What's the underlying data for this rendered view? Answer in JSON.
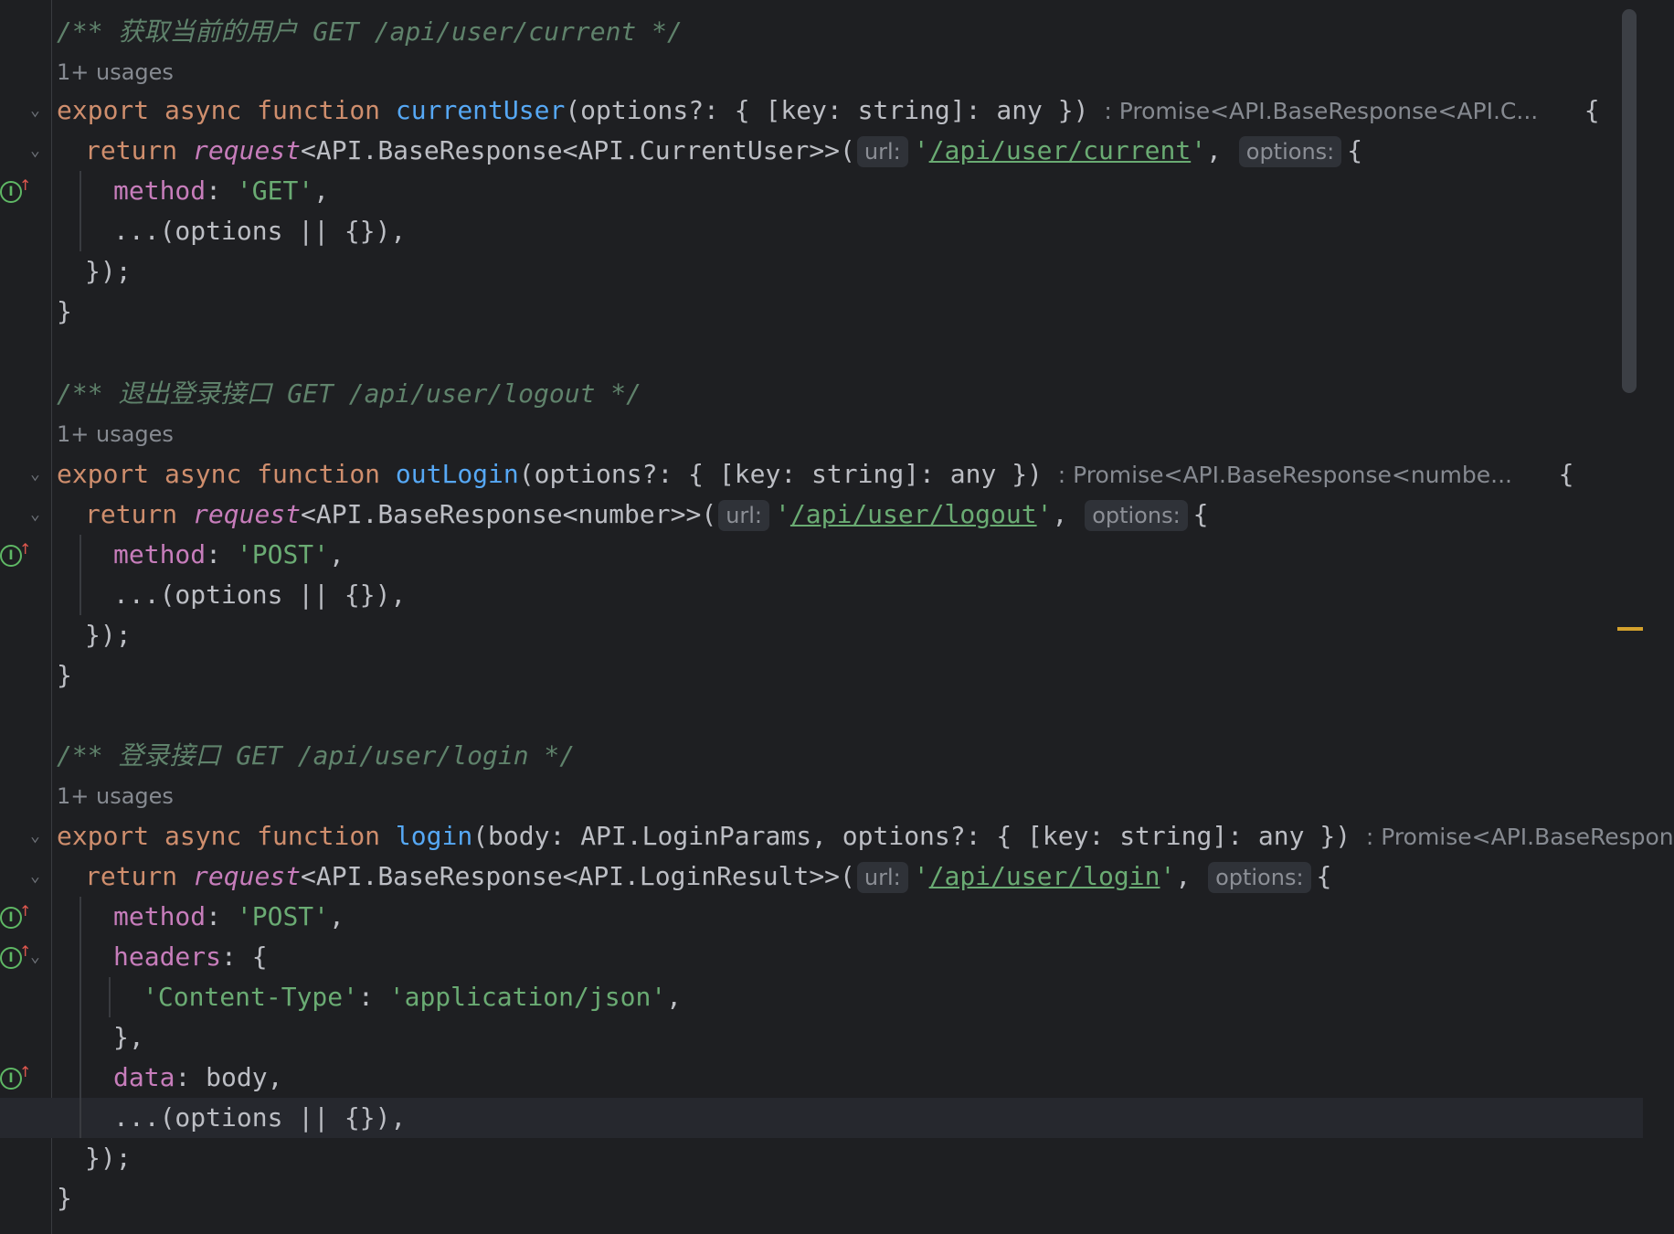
{
  "usages": "1+ usages",
  "blocks": [
    {
      "comment": "/** 获取当前的用户 GET /api/user/current */",
      "fn_name": "currentUser",
      "params": "(options?: { [key: string]: any })",
      "return_hint": ": Promise<API.BaseResponse<API.C...",
      "request_generic": "<API.BaseResponse<API.CurrentUser>>(",
      "url": "/api/user/current",
      "method": "'GET'"
    },
    {
      "comment": "/** 退出登录接口 GET /api/user/logout */",
      "fn_name": "outLogin",
      "params": "(options?: { [key: string]: any })",
      "return_hint": ": Promise<API.BaseResponse<numbe...",
      "request_generic": "<API.BaseResponse<number>>(",
      "url": "/api/user/logout",
      "method": "'POST'"
    },
    {
      "comment": "/** 登录接口 GET /api/user/login */",
      "fn_name": "login",
      "params": "(body: API.LoginParams, options?: { [key: string]: any })",
      "return_hint": ": Promise<API.BaseResponse<AP",
      "request_generic": "<API.BaseResponse<API.LoginResult>>(",
      "url": "/api/user/login",
      "method": "'POST'",
      "header_key": "'Content-Type'",
      "header_value": "'application/json'"
    }
  ],
  "code": {
    "export_kw": "export",
    "async_kw": "async",
    "function_kw": "function",
    "return_kw": "return",
    "request_fn": "request",
    "url_hint": "url:",
    "options_hint": "options:",
    "method_key": "method",
    "headers_key": "headers",
    "data_key": "data",
    "body_ident": "body",
    "spread": "...(options || {}),",
    "open_brace": "{",
    "close_call": "});",
    "close_brace": "}",
    "close_obj": "},"
  },
  "colors": {
    "background": "#1e1f22",
    "keyword": "#cf8e6d",
    "function": "#56a8f5",
    "property": "#c77dbb",
    "string": "#6aab73",
    "comment": "#5f826b"
  },
  "icons": [
    "fold-chevron-icon",
    "implements-method-icon"
  ]
}
